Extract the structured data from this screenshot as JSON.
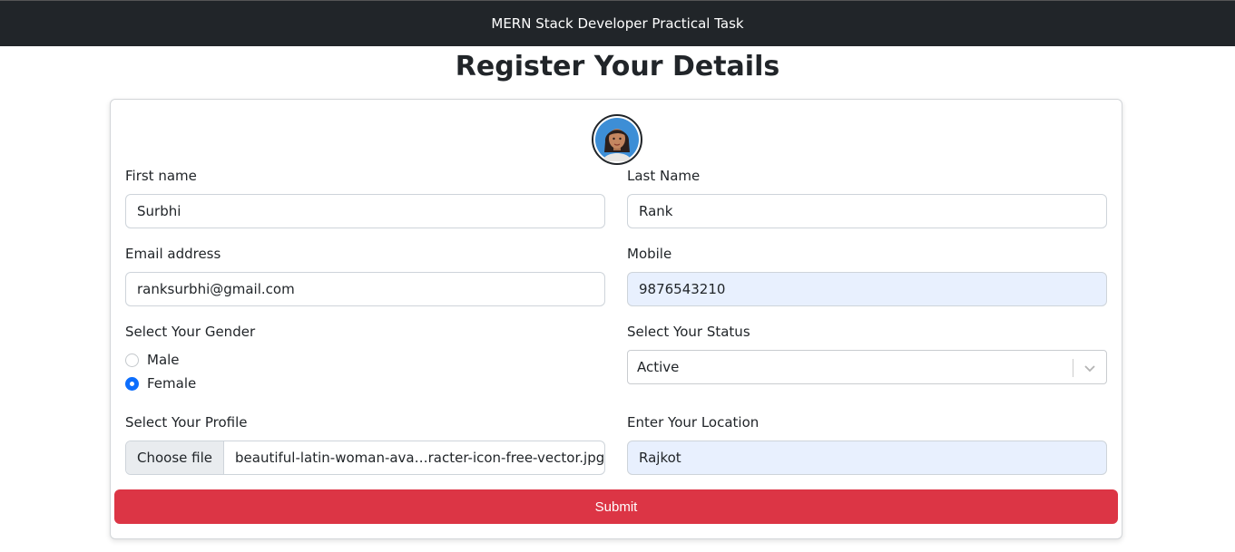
{
  "navbar": {
    "brand": "MERN Stack Developer Practical Task"
  },
  "page_title": "Register Your Details",
  "avatar": {
    "icon": "woman-avatar-icon"
  },
  "form": {
    "first_name": {
      "label": "First name",
      "value": "Surbhi"
    },
    "last_name": {
      "label": "Last Name",
      "value": "Rank"
    },
    "email": {
      "label": "Email address",
      "value": "ranksurbhi@gmail.com"
    },
    "mobile": {
      "label": "Mobile",
      "value": "9876543210"
    },
    "gender": {
      "label": "Select Your Gender",
      "options": [
        {
          "label": "Male",
          "checked": false
        },
        {
          "label": "Female",
          "checked": true
        }
      ]
    },
    "status": {
      "label": "Select Your Status",
      "value": "Active"
    },
    "profile": {
      "label": "Select Your Profile",
      "button": "Choose file",
      "file_name": "beautiful-latin-woman-ava…racter-icon-free-vector.jpg"
    },
    "location": {
      "label": "Enter Your Location",
      "value": "Rajkot"
    },
    "submit_label": "Submit"
  },
  "colors": {
    "navbar_bg": "#212529",
    "submit_bg": "#dc3545",
    "radio_checked": "#0d6efd",
    "autofill_bg": "#e8f0fe"
  }
}
